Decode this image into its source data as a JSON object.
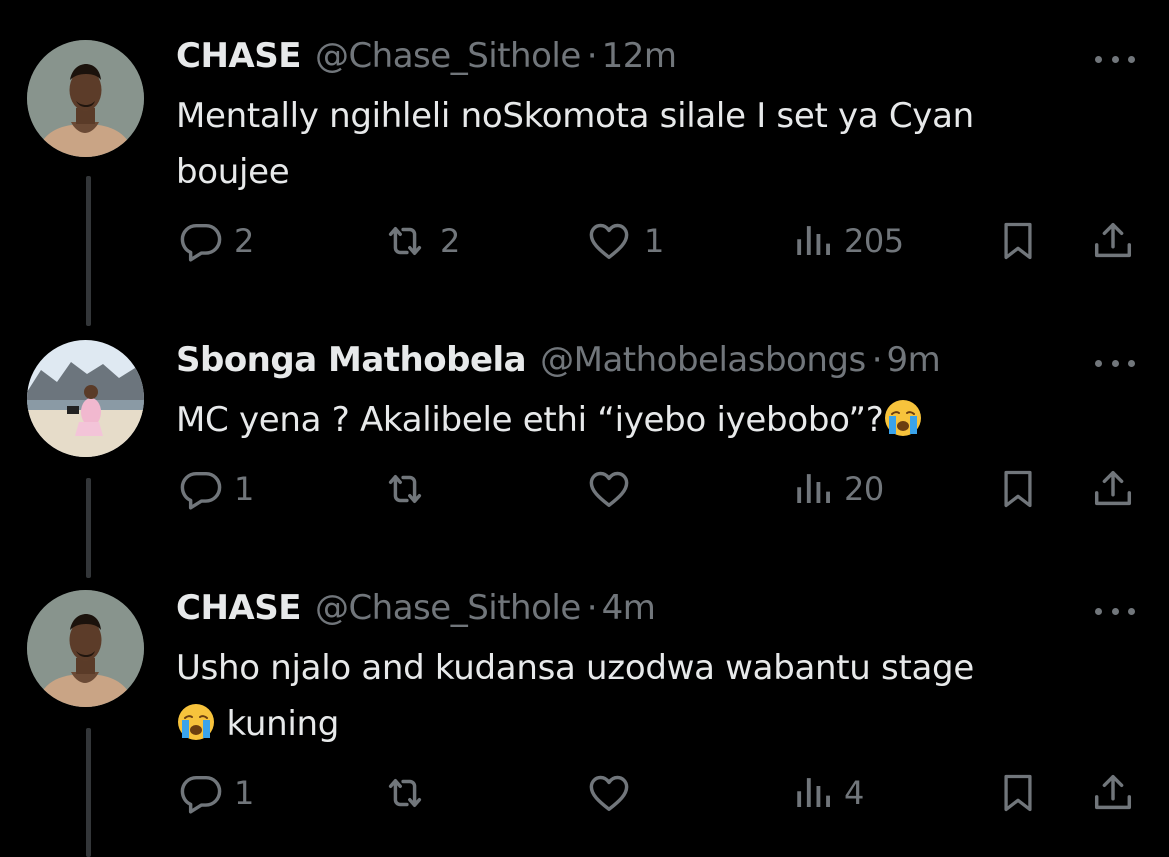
{
  "colors": {
    "background": "#000000",
    "primary_text": "#e7e9ea",
    "secondary_text": "#71767b",
    "thread_line": "#333639"
  },
  "tweets": [
    {
      "name": "CHASE",
      "handle": "@Chase_Sithole",
      "separator": "·",
      "time": "12m",
      "text_line1": "Mentally ngihleli noSkomota silale I set ya Cyan",
      "text_line2": "boujee",
      "replies": "2",
      "retweets": "2",
      "likes": "1",
      "views": "205",
      "avatar": "avatar-chase"
    },
    {
      "name": "Sbonga Mathobela",
      "handle": "@Mathobelasbongs",
      "separator": "·",
      "time": "9m",
      "text_line1": "MC yena ? Akalibele ethi “iyebo iyebobo”?",
      "emoji": "loudly-crying-face-emoji",
      "replies": "1",
      "retweets": "",
      "likes": "",
      "views": "20",
      "avatar": "avatar-sbonga"
    },
    {
      "name": "CHASE",
      "handle": "@Chase_Sithole",
      "separator": "·",
      "time": "4m",
      "text_line1": "Usho njalo and kudansa uzodwa wabantu stage",
      "text_line2": "kuning",
      "emoji": "loudly-crying-face-emoji",
      "replies": "1",
      "retweets": "",
      "likes": "",
      "views": "4",
      "avatar": "avatar-chase"
    }
  ],
  "icons": {
    "reply": "reply-icon",
    "retweet": "retweet-icon",
    "like": "heart-icon",
    "views": "views-icon",
    "bookmark": "bookmark-icon",
    "share": "share-icon",
    "more": "more-icon"
  }
}
